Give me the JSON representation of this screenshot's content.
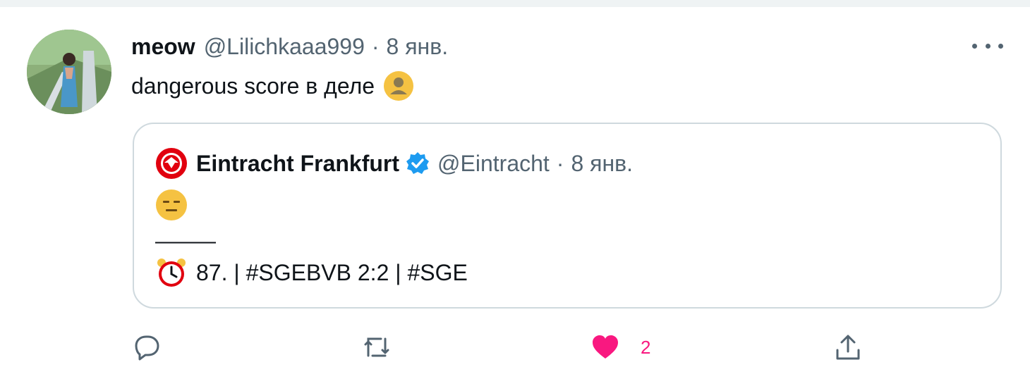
{
  "tweet": {
    "author_name": "meow",
    "handle": "@Lilichkaaa999",
    "separator": "·",
    "date": "8 янв.",
    "text": "dangerous score в деле",
    "text_emoji_icon": "bust-in-silhouette-emoji-icon",
    "more_icon": "more-dots-icon"
  },
  "quoted": {
    "author_name": "Eintracht Frankfurt",
    "verified_icon": "verified-badge-icon",
    "handle": "@Eintracht",
    "separator": "·",
    "date": "8 янв.",
    "line1_emoji_icon": "expressionless-face-emoji-icon",
    "divider": "———",
    "line3_icon": "alarm-clock-emoji-icon",
    "line3_text": "87. | #SGEBVB 2:2 | #SGE"
  },
  "actions": {
    "reply_icon": "reply-icon",
    "retweet_icon": "retweet-icon",
    "like_icon": "heart-icon",
    "like_count": "2",
    "share_icon": "share-icon"
  },
  "colors": {
    "text_primary": "#0f1419",
    "text_secondary": "#536471",
    "like_pink": "#f91880",
    "verified_blue": "#1d9bf0",
    "border": "#cfd9de"
  }
}
